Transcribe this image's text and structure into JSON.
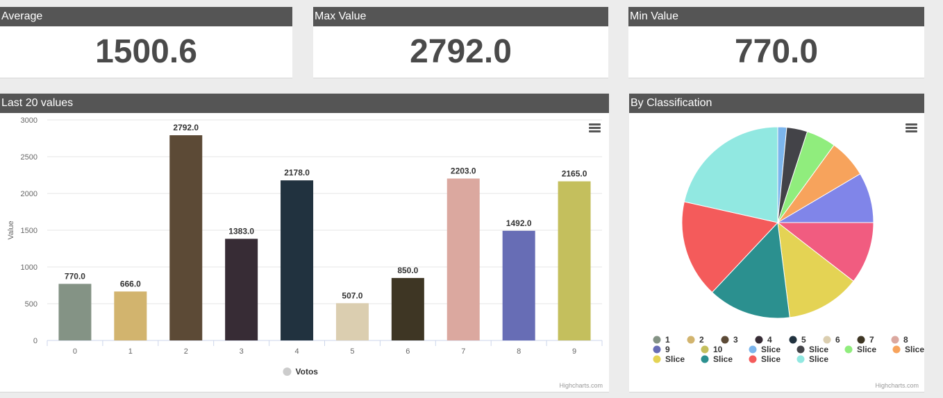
{
  "stats": [
    {
      "title": "Average",
      "value": "1500.6"
    },
    {
      "title": "Max Value",
      "value": "2792.0"
    },
    {
      "title": "Min Value",
      "value": "770.0"
    }
  ],
  "bar_panel": {
    "title": "Last 20 values",
    "credits": "Highcharts.com",
    "legend_label": "Votos"
  },
  "pie_panel": {
    "title": "By Classification",
    "credits": "Highcharts.com"
  },
  "chart_data": [
    {
      "type": "bar",
      "title": "",
      "xlabel": "",
      "ylabel": "Value",
      "ylim": [
        0,
        3000
      ],
      "yticks": [
        0,
        500,
        1000,
        1500,
        2000,
        2500,
        3000
      ],
      "categories": [
        "0",
        "1",
        "2",
        "3",
        "4",
        "5",
        "6",
        "7",
        "8",
        "9"
      ],
      "values": [
        770.0,
        666.0,
        2792.0,
        1383.0,
        2178.0,
        507.0,
        850.0,
        2203.0,
        1492.0,
        2165.0
      ],
      "data_labels": [
        "770.0",
        "666.0",
        "2792.0",
        "1383.0",
        "2178.0",
        "507.0",
        "850.0",
        "2203.0",
        "1492.0",
        "2165.0"
      ],
      "colors": [
        "#849385",
        "#d2b46e",
        "#5c4a36",
        "#372c35",
        "#21323f",
        "#dbceb0",
        "#3e3624",
        "#dba89f",
        "#676db5",
        "#c4bf5d"
      ],
      "series": [
        {
          "name": "Votos",
          "legend_color": "#cccccc"
        }
      ],
      "grid": true,
      "legend": "bottom"
    },
    {
      "type": "pie",
      "title": "",
      "legend": "bottom",
      "slices": [
        {
          "label": "1",
          "value": 0,
          "color": "#849385"
        },
        {
          "label": "2",
          "value": 0,
          "color": "#d2b46e"
        },
        {
          "label": "3",
          "value": 0,
          "color": "#5c4a36"
        },
        {
          "label": "4",
          "value": 0,
          "color": "#372c35"
        },
        {
          "label": "5",
          "value": 0,
          "color": "#21323f"
        },
        {
          "label": "6",
          "value": 0,
          "color": "#dbceb0"
        },
        {
          "label": "7",
          "value": 0,
          "color": "#3e3624"
        },
        {
          "label": "8",
          "value": 0,
          "color": "#dba89f"
        },
        {
          "label": "9",
          "value": 0,
          "color": "#676db5"
        },
        {
          "label": "10",
          "value": 0,
          "color": "#c4bf5d"
        },
        {
          "label": "Slice",
          "value": 1.5,
          "color": "#7cb5ec"
        },
        {
          "label": "Slice",
          "value": 3.5,
          "color": "#434348"
        },
        {
          "label": "Slice",
          "value": 5.0,
          "color": "#90ed7d"
        },
        {
          "label": "Slice",
          "value": 6.5,
          "color": "#f7a35c"
        },
        {
          "label": "Slice",
          "value": 8.5,
          "color": "#8085e9"
        },
        {
          "label": "Slice",
          "value": 10.5,
          "color": "#f15c80"
        },
        {
          "label": "Slice",
          "value": 12.5,
          "color": "#e4d354"
        },
        {
          "label": "Slice",
          "value": 14.0,
          "color": "#2b908f"
        },
        {
          "label": "Slice",
          "value": 16.5,
          "color": "#f45b5b"
        },
        {
          "label": "Slice",
          "value": 21.5,
          "color": "#91e8e1"
        }
      ]
    }
  ]
}
